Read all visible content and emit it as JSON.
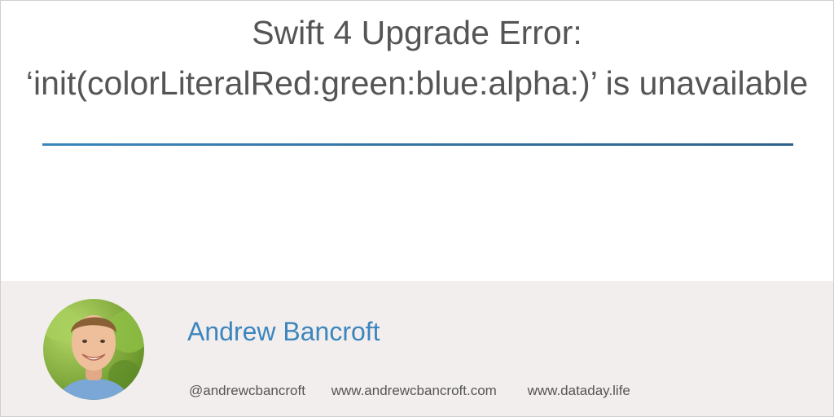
{
  "title": "Swift 4 Upgrade Error: ‘init(colorLiteralRed:green:blue:alpha:)’ is unavailable",
  "author": {
    "name": "Andrew Bancroft",
    "avatar_icon": "author-avatar-photo"
  },
  "links": {
    "handle": "@andrewcbancroft",
    "site1": "www.andrewcbancroft.com",
    "site2": "www.dataday.life"
  },
  "colors": {
    "accent": "#3b86bd",
    "title_text": "#555555",
    "footer_bg": "#f3eeee"
  }
}
